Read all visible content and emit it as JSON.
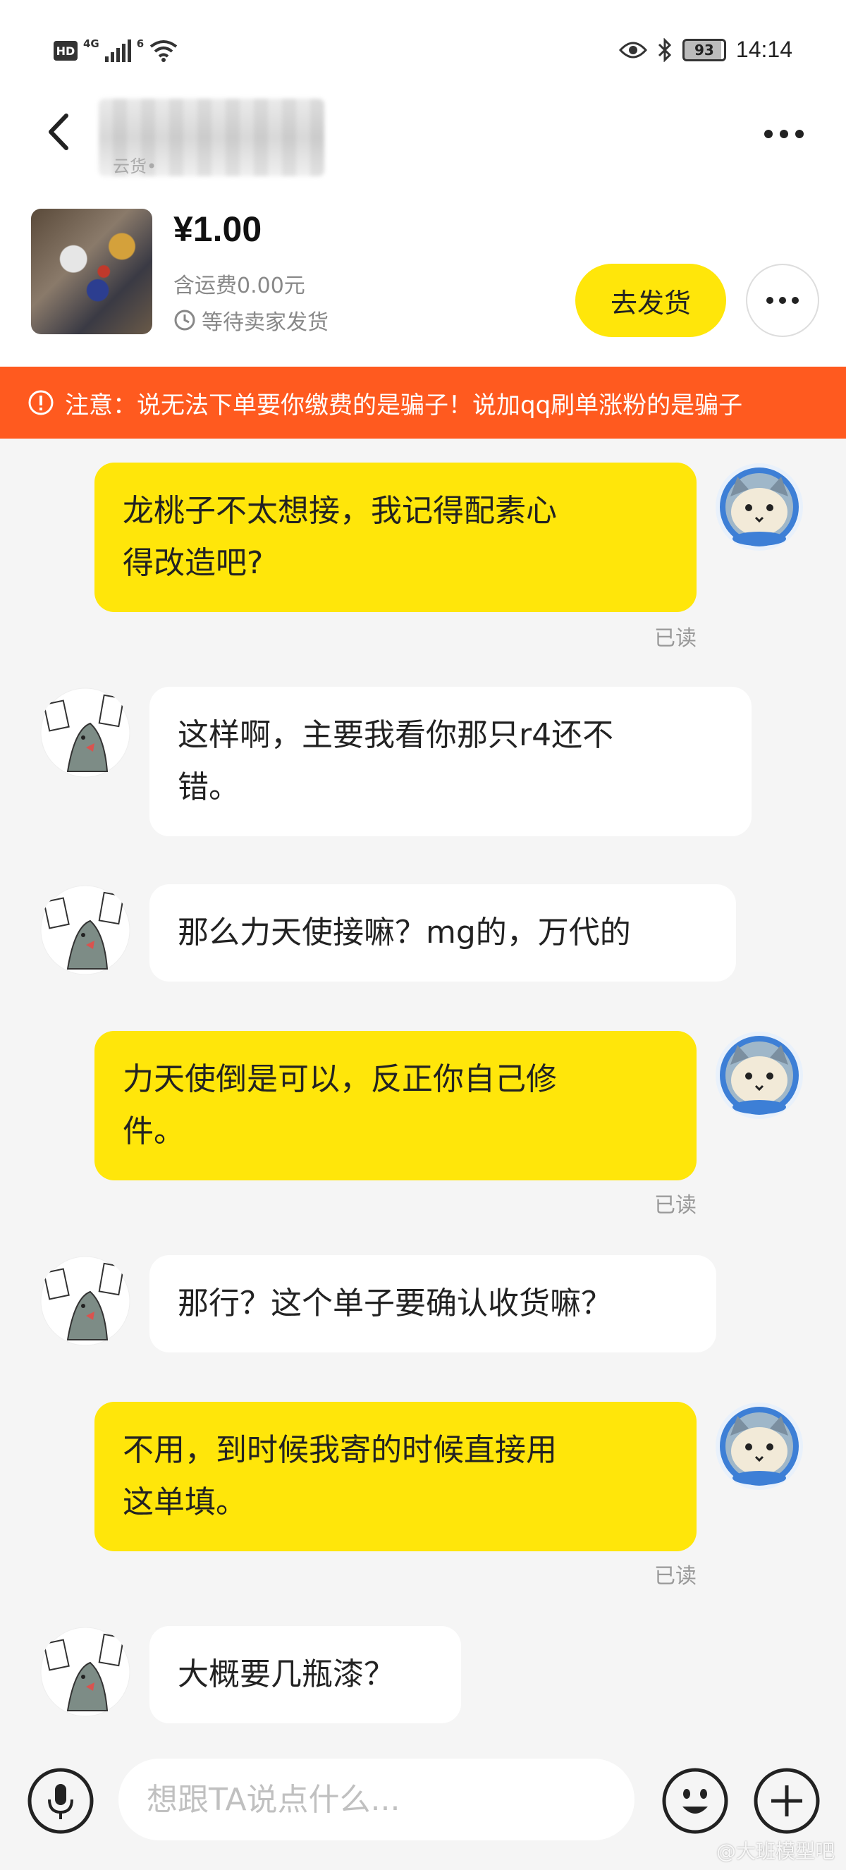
{
  "status_bar": {
    "hd_label": "HD",
    "network": "4G",
    "wifi_label": "6",
    "battery": "93",
    "time": "14:14"
  },
  "header": {
    "title_subtext": "云货•",
    "more_icon": "more-horizontal-icon",
    "back_icon": "chevron-left-icon"
  },
  "product": {
    "price": "¥1.00",
    "shipping": "含运费0.00元",
    "status": "等待卖家发货",
    "ship_button": "去发货"
  },
  "warning": {
    "text": "注意：说无法下单要你缴费的是骗子！说加qq刷单涨粉的是骗子"
  },
  "messages": [
    {
      "from": "me",
      "lines": "龙桃子不太想接，我记得配素心\n得改造吧?",
      "read": "已读"
    },
    {
      "from": "them",
      "lines": "这样啊，主要我看你那只r4还不\n错。"
    },
    {
      "from": "them",
      "lines": "那么力天使接嘛？mg的，万代的"
    },
    {
      "from": "me",
      "lines": "力天使倒是可以，反正你自己修\n件。",
      "read": "已读"
    },
    {
      "from": "them",
      "lines": "那行？这个单子要确认收货嘛？"
    },
    {
      "from": "me",
      "lines": "不用，到时候我寄的时候直接用\n这单填。",
      "read": "已读"
    },
    {
      "from": "them",
      "lines": "大概要几瓶漆？"
    }
  ],
  "input": {
    "placeholder": "想跟TA说点什么..."
  },
  "watermark": "@大班模型吧",
  "colors": {
    "accent_yellow": "#ffe60a",
    "warning_orange": "#ff5a1f"
  }
}
